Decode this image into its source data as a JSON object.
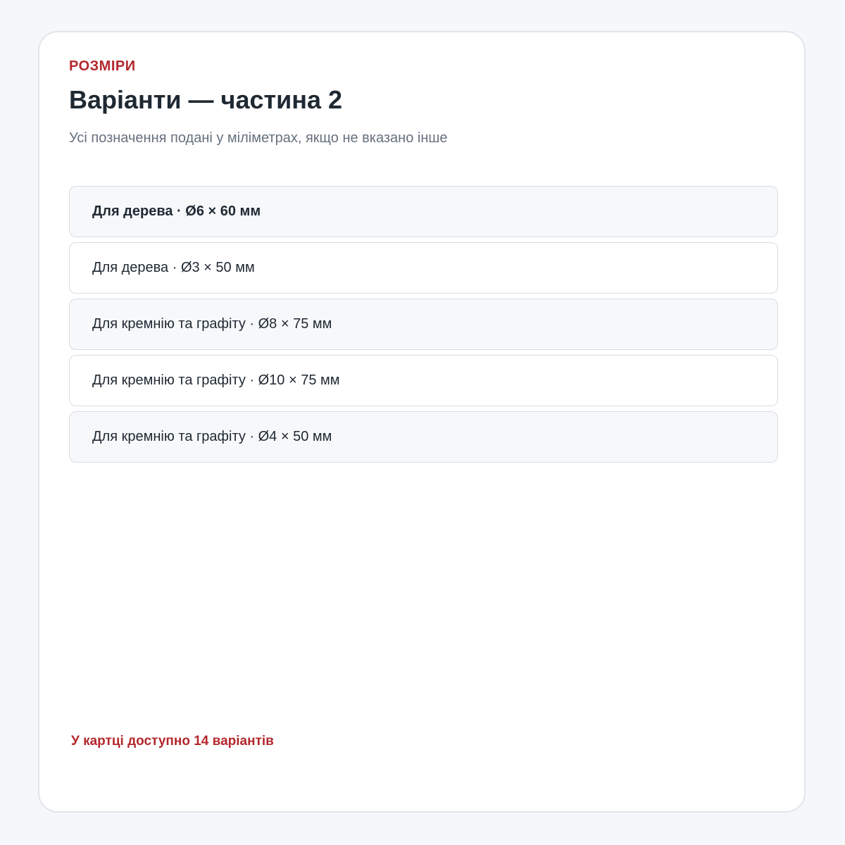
{
  "header": {
    "eyebrow": "РОЗМІРИ",
    "title": "Варіанти — частина 2",
    "subtitle": "Усі позначення подані у міліметрах, якщо не вказано інше"
  },
  "variants": [
    {
      "label": "Для дерева · Ø6 × 60 мм",
      "selected": true
    },
    {
      "label": "Для дерева · Ø3 × 50 мм",
      "selected": false
    },
    {
      "label": "Для кремнію та графіту · Ø8 × 75 мм",
      "selected": false
    },
    {
      "label": "Для кремнію та графіту · Ø10 × 75 мм",
      "selected": false
    },
    {
      "label": "Для кремнію та графіту · Ø4 × 50 мм",
      "selected": false
    }
  ],
  "footer": {
    "note": "У картці доступно 14 варіантів"
  },
  "colors": {
    "accent": "#b3282d",
    "text": "#1f2933",
    "muted": "#66717e",
    "border": "#d7dce2",
    "page_background": "#f5f7fa"
  }
}
